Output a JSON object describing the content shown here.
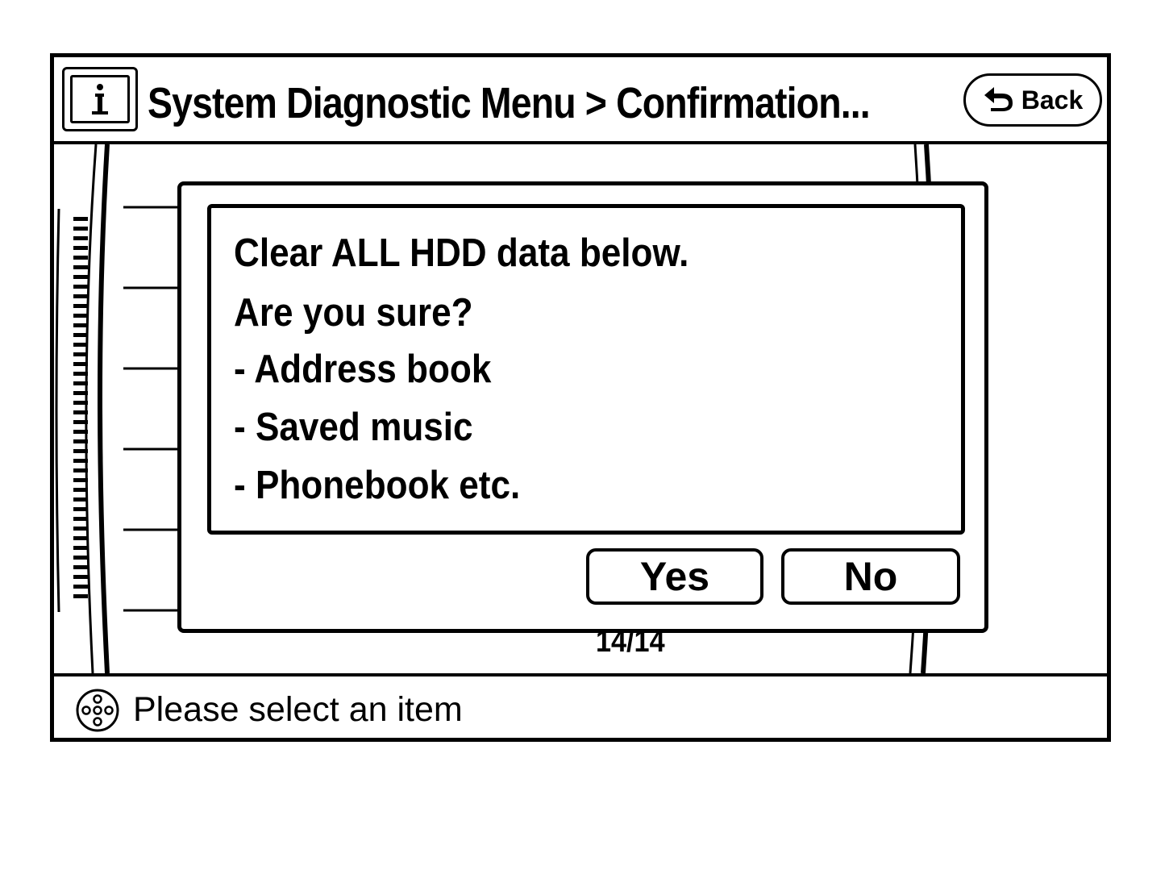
{
  "header": {
    "title": "System Diagnostic Menu > Confirmation...",
    "info_icon": "info-icon",
    "back_label": "Back",
    "back_icon": "back-arrow-icon"
  },
  "dialog": {
    "lines": [
      "Clear ALL HDD data below.",
      "Are you sure?",
      "- Address book",
      "- Saved music",
      "- Phonebook etc."
    ],
    "yes_label": "Yes",
    "no_label": "No"
  },
  "list": {
    "page_indicator": "14/14"
  },
  "status": {
    "icon": "joystick-icon",
    "text": "Please select an item"
  }
}
